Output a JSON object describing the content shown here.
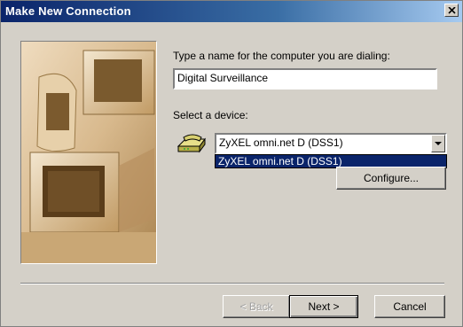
{
  "window": {
    "title": "Make New Connection"
  },
  "form": {
    "name_label": "Type a name for the computer you are dialing:",
    "name_value": "Digital Surveillance",
    "device_label": "Select a device:",
    "device_selected": "ZyXEL omni.net D (DSS1)",
    "device_options": [
      "ZyXEL omni.net D (DSS1)"
    ],
    "configure_label": "Configure..."
  },
  "buttons": {
    "back": "< Back",
    "next": "Next >",
    "cancel": "Cancel"
  },
  "icons": [
    "close-icon",
    "modem-icon",
    "chevron-down-icon",
    "computer-illustration"
  ],
  "colors": {
    "title_bar": "#0a246a",
    "selection": "#0a246a",
    "dialog": "#d4d0c8"
  }
}
